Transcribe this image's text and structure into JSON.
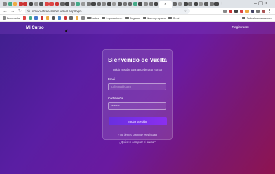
{
  "browser": {
    "url": "school-three-amber.vercel.app/login",
    "tab_colors": [
      "#888",
      "#4a8",
      "#ea4",
      "#c33",
      "#c33",
      "#444",
      "#999",
      "#555",
      "#d44",
      "#d44",
      "#c33",
      "#666",
      "#444",
      "#888",
      "#4a8",
      "#999",
      "#777",
      "#444",
      "#666",
      "#888",
      "#444",
      "#999",
      "#555",
      "#777",
      "#666",
      "#4a8",
      "#444",
      "#888",
      "#777",
      "#444",
      "#666",
      "#999",
      "#444",
      "#777",
      "#444",
      "#999",
      "#555",
      "#777",
      "#444"
    ],
    "active_tab_close": "×",
    "new_tab": "+",
    "window_controls": "–  ▢  ×",
    "extension_colors": [
      "#888",
      "#c33",
      "#444",
      "#d44",
      "#ea4",
      "#446",
      "#777",
      "#a55"
    ],
    "bookmarks": [
      {
        "label": "Bookmarks",
        "color": "#888",
        "folder": false
      },
      {
        "label": "",
        "color": "#d44",
        "folder": false
      },
      {
        "label": "",
        "color": "#4a8",
        "folder": false
      },
      {
        "label": "",
        "color": "#47c",
        "folder": false
      },
      {
        "label": "",
        "color": "#c33",
        "folder": false
      },
      {
        "label": "",
        "color": "#ea4",
        "folder": false
      },
      {
        "label": "",
        "color": "#555",
        "folder": false
      },
      {
        "label": "",
        "color": "#48c",
        "folder": false
      },
      {
        "label": "",
        "color": "#c33",
        "folder": false
      },
      {
        "label": "",
        "color": "#666",
        "folder": false
      },
      {
        "label": "",
        "color": "#ea4",
        "folder": false
      },
      {
        "label": "",
        "color": "#888",
        "folder": false
      },
      {
        "label": "Nubes",
        "color": "#666",
        "folder": true
      },
      {
        "label": "Importaciones",
        "color": "#666",
        "folder": true
      },
      {
        "label": "Pagados",
        "color": "#666",
        "folder": true
      },
      {
        "label": "Nuevo proyecto",
        "color": "#666",
        "folder": true
      },
      {
        "label": "Gmail",
        "color": "#666",
        "folder": true
      }
    ],
    "all_bookmarks": "Todos los marcadores"
  },
  "app": {
    "brand": "Mi Curso",
    "register_link": "Registrarse"
  },
  "login": {
    "title": "Bienvenido de Vuelta",
    "subtitle": "Inicia sesión para acceder a tu curso",
    "email_label": "Email",
    "email_placeholder": "tu@email.com",
    "password_label": "Contraseña",
    "password_placeholder": "••••••••",
    "submit_label": "Iniciar Sesión",
    "no_account_prefix": "¿No tienes cuenta? ",
    "no_account_link": "Registrate",
    "buy_course_link": "¿Quieres comprar el curso?"
  }
}
